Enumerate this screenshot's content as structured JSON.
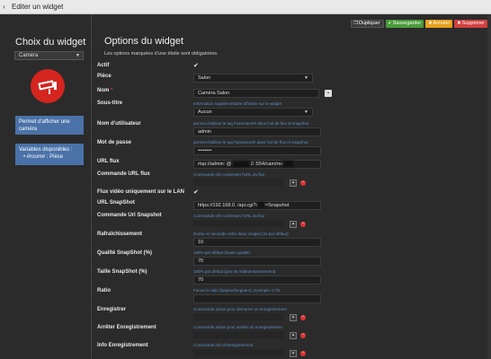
{
  "titlebar": {
    "title": "Editer un widget"
  },
  "buttons": {
    "duplicate": "Dupliquer",
    "save": "Sauvegarder",
    "cancel": "Annuler",
    "delete": "Supprimer"
  },
  "left": {
    "title": "Choix du widget",
    "widget_type": "Caméra",
    "info1": "Permet d'afficher une caméra",
    "info2_title": "Variables disponibles :",
    "info2_item": "#room# : Pièce"
  },
  "options": {
    "title": "Options du widget",
    "note": "Les options marquées d'une étoile sont obligatoires.",
    "actif_label": "Actif",
    "piece_label": "Pièce",
    "piece_value": "Salon",
    "nom_label": "Nom",
    "nom_value": "Caméra Salon",
    "soustitre_label": "Sous-titre",
    "soustitre_hint": "Information supplémentaire affichée sur le widget",
    "soustitre_value": "Aucun",
    "user_label": "Nom d'utilisateur",
    "user_hint": "permet d'utiliser le tag #username# dans l'url de flux et snapshot",
    "user_value": "admin",
    "pass_label": "Mot de passe",
    "pass_hint": "permet d'utiliser le tag #password# dans l'url de flux et snapshot",
    "pass_value": "••••••••",
    "url_label": "URL flux",
    "url_value": "rtsp://admin:           @192.168.0      :554/cam/realn",
    "cmdurl_label": "Commande URL flux",
    "cmdurl_hint": "Commande info contenant l'URL du flux",
    "lan_label": "Flux vidéo uniquement sur le LAN",
    "snap_label": "URL SnapShot",
    "snap_value": "https://192.168.0.      /api.cgi?cmd=Snapshot",
    "cmdsnap_label": "Commande Url Snapshot",
    "cmdsnap_hint": "Commande info contenant l'URL du flux",
    "refresh_label": "Rafraîchissement",
    "refresh_hint": "Durée en seconde entre deux images (1s par défaut)",
    "refresh_value": "10",
    "quality_label": "Qualité SnapShot (%)",
    "quality_hint": "100% par défaut (haute qualité)",
    "quality_value": "70",
    "size_label": "Taille SnapShot (%)",
    "size_hint": "100% par défaut (pas de redimensionnement)",
    "size_value": "70",
    "ratio_label": "Ratio",
    "ratio_hint": "Forcer le ratio (largeur/longueur). Exemple: 0.75",
    "rec_label": "Enregistrer",
    "rec_hint": "Commande action pour démarrer un enregistrement",
    "stop_label": "Arrêter Enregistrement",
    "stop_hint": "Commande action pour arrêter un enregistrement",
    "info_label": "Info Enregistrement",
    "info_hint": "Commande info d'enregistrement"
  },
  "colors": {
    "accent_blue": "#4a72a8",
    "save_green": "#4a9c3a",
    "cancel_orange": "#e6a01c",
    "delete_red": "#d04040"
  }
}
